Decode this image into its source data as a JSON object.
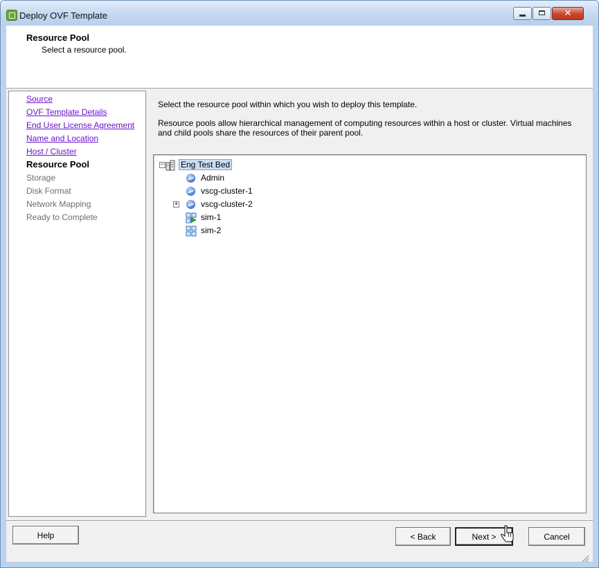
{
  "window": {
    "title": "Deploy OVF Template",
    "close_glyph": "✕"
  },
  "header": {
    "title": "Resource Pool",
    "subtitle": "Select a resource pool."
  },
  "nav": {
    "items": [
      {
        "label": "Source",
        "state": "visited"
      },
      {
        "label": "OVF Template Details",
        "state": "visited"
      },
      {
        "label": "End User License Agreement",
        "state": "visited"
      },
      {
        "label": "Name and Location",
        "state": "visited"
      },
      {
        "label": "Host / Cluster",
        "state": "visited"
      },
      {
        "label": "Resource Pool",
        "state": "current"
      },
      {
        "label": "Storage",
        "state": "future"
      },
      {
        "label": "Disk Format",
        "state": "future"
      },
      {
        "label": "Network Mapping",
        "state": "future"
      },
      {
        "label": "Ready to Complete",
        "state": "future"
      }
    ]
  },
  "main": {
    "intro": "Select the resource pool within which you wish to deploy this template.",
    "description": "Resource pools allow hierarchical management of computing resources within a host or cluster. Virtual machines and child pools share the resources of their parent pool."
  },
  "tree": {
    "root": {
      "label": "Eng Test Bed",
      "icon": "datacenter-icon",
      "expander": "−",
      "selected": true
    },
    "children": [
      {
        "label": "Admin",
        "icon": "resource-pool-icon"
      },
      {
        "label": "vscg-cluster-1",
        "icon": "resource-pool-icon"
      },
      {
        "label": "vscg-cluster-2",
        "icon": "resource-pool-icon",
        "expander": "+"
      },
      {
        "label": "sim-1",
        "icon": "vapp-running-icon"
      },
      {
        "label": "sim-2",
        "icon": "vapp-icon"
      }
    ]
  },
  "buttons": {
    "help": "Help",
    "back": "< Back",
    "next": "Next >",
    "cancel": "Cancel"
  },
  "colors": {
    "link": "#6b10cc",
    "selection": "#c9ddf3",
    "frame": "#bcd3ee"
  }
}
